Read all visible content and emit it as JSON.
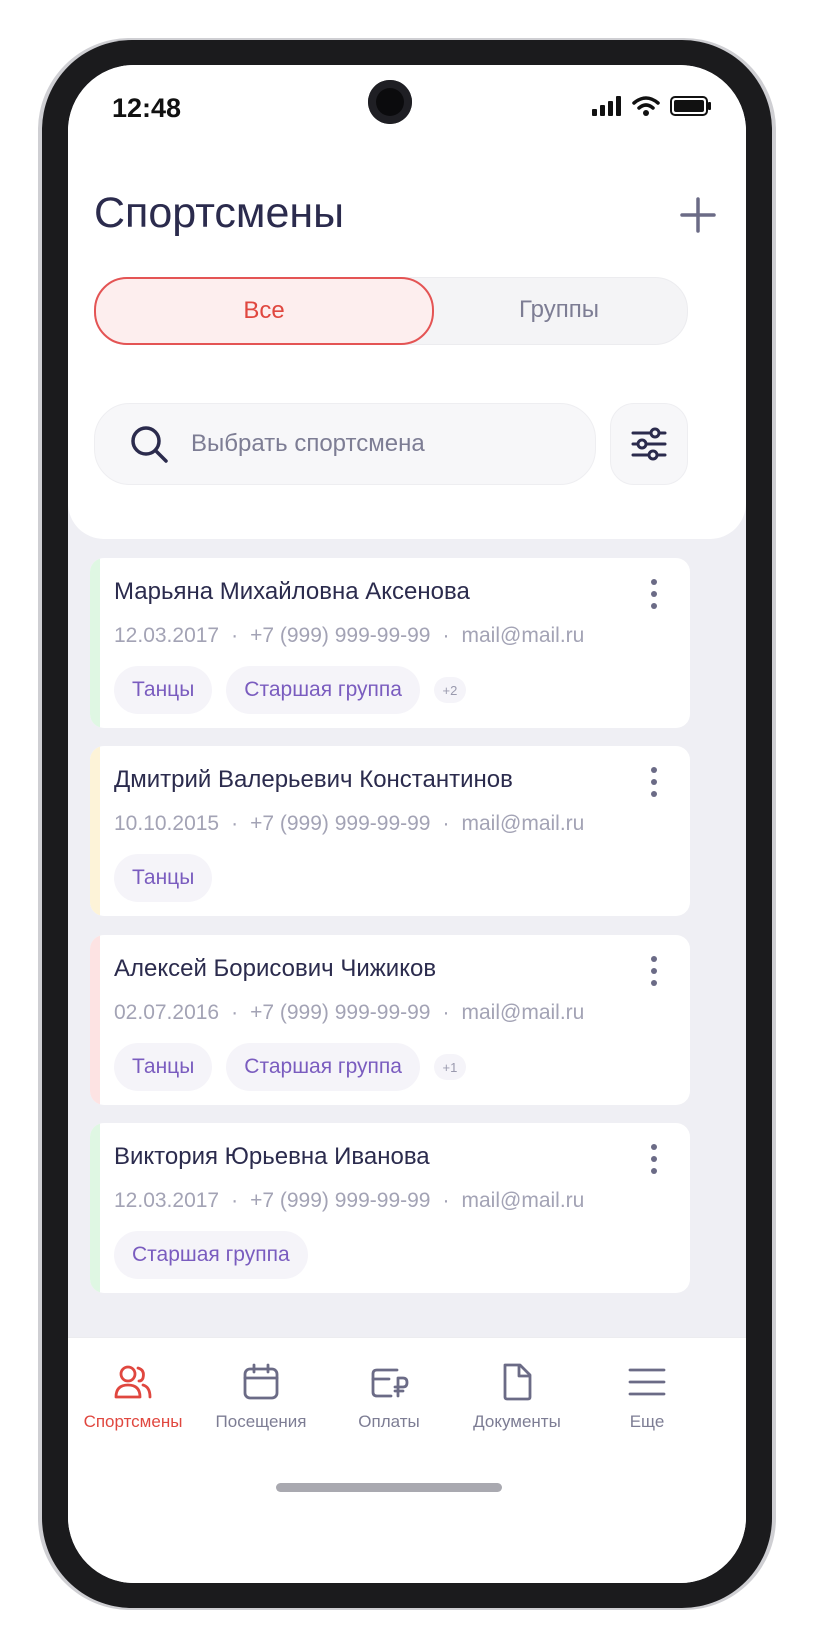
{
  "status": {
    "time": "12:48"
  },
  "header": {
    "title": "Спортсмены"
  },
  "tabs": {
    "all": "Все",
    "groups": "Группы"
  },
  "search": {
    "placeholder": "Выбрать спортсмена"
  },
  "athletes": [
    {
      "name": "Марьяна Михайловна Аксенова",
      "birthdate": "12.03.2017",
      "phone": "+7 (999) 999-99-99",
      "email": "mail@mail.ru",
      "tags": [
        "Танцы",
        "Старшая группа"
      ],
      "more": "+2",
      "accent": "#dff7e3"
    },
    {
      "name": "Дмитрий Валерьевич Константинов",
      "birthdate": "10.10.2015",
      "phone": "+7 (999) 999-99-99",
      "email": "mail@mail.ru",
      "tags": [
        "Танцы"
      ],
      "more": "",
      "accent": "#fdf3d8"
    },
    {
      "name": "Алексей Борисович Чижиков",
      "birthdate": "02.07.2016",
      "phone": "+7 (999) 999-99-99",
      "email": "mail@mail.ru",
      "tags": [
        "Танцы",
        "Старшая группа"
      ],
      "more": "+1",
      "accent": "#fde3e3"
    },
    {
      "name": "Виктория Юрьевна Иванова",
      "birthdate": "12.03.2017",
      "phone": "+7 (999) 999-99-99",
      "email": "mail@mail.ru",
      "tags": [
        "Старшая группа"
      ],
      "more": "",
      "accent": "#dff7e3"
    }
  ],
  "nav": {
    "athletes": "Спортсмены",
    "visits": "Посещения",
    "payments": "Оплаты",
    "documents": "Документы",
    "more": "Еще"
  },
  "colors": {
    "accent": "#e0473f",
    "text": "#2b2b4d",
    "tag_text": "#7a5cbf"
  }
}
